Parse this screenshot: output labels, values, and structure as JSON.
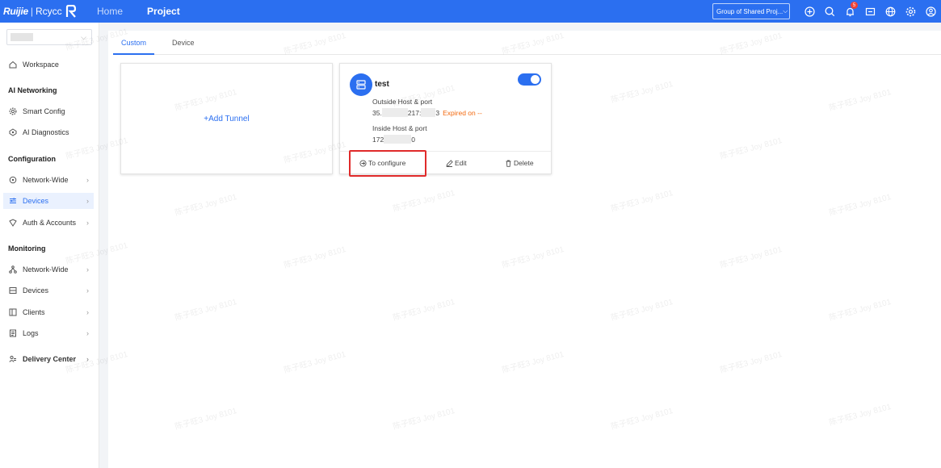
{
  "header": {
    "brand": "Ruijie",
    "product": "Rcycc",
    "nav": [
      {
        "label": "Home",
        "active": false
      },
      {
        "label": "Project",
        "active": true
      }
    ],
    "group_select": "Group of Shared Proj...",
    "notification_count": "5",
    "accent": "#2b6ff0"
  },
  "sidebar": {
    "workspace": "Workspace",
    "sections": {
      "ai_networking": "AI Networking",
      "configuration": "Configuration",
      "monitoring": "Monitoring"
    },
    "items": {
      "smart_config": "Smart Config",
      "ai_diagnostics": "AI Diagnostics",
      "cfg_network_wide": "Network-Wide",
      "cfg_devices": "Devices",
      "auth_accounts": "Auth & Accounts",
      "mon_network_wide": "Network-Wide",
      "mon_devices": "Devices",
      "clients": "Clients",
      "logs": "Logs",
      "delivery_center": "Delivery Center"
    }
  },
  "tabs": [
    {
      "label": "Custom",
      "active": true
    },
    {
      "label": "Device",
      "active": false
    }
  ],
  "add_tunnel": "+Add Tunnel",
  "tunnel": {
    "name": "test",
    "enabled": true,
    "outside_label": "Outside Host & port",
    "outside_prefix": "35.",
    "outside_mid": "217:",
    "outside_suffix": "3",
    "expired": "Expired on --",
    "inside_label": "Inside Host & port",
    "inside_prefix": "172",
    "inside_suffix": "0",
    "actions": {
      "configure": "To configure",
      "edit": "Edit",
      "delete": "Delete"
    }
  },
  "watermark": "陈子旺3 Joy 8101"
}
